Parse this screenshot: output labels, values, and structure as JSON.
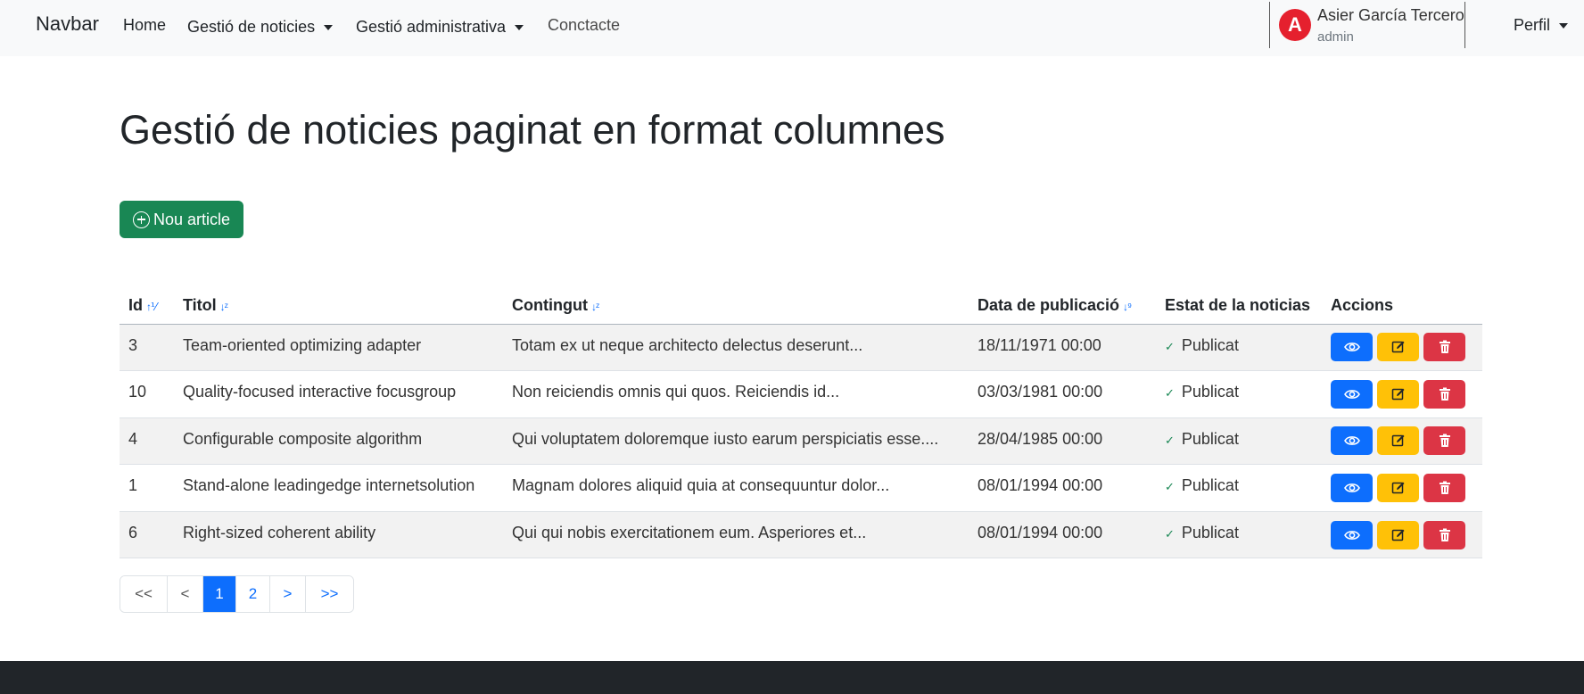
{
  "navbar": {
    "brand": "Navbar",
    "links": {
      "home": "Home",
      "gestio_noticies": "Gestió de noticies",
      "gestio_administrativa": "Gestió administrativa",
      "contacte": "Conctacte"
    },
    "user": {
      "avatar_letter": "A",
      "name": "Asier García Tercero",
      "role": "admin"
    },
    "perfil": "Perfil"
  },
  "page": {
    "title": "Gestió de noticies paginat en format columnes",
    "new_button": "Nou article"
  },
  "table": {
    "headers": {
      "id": "Id",
      "titol": "Titol",
      "contingut": "Contingut",
      "data": "Data de publicació",
      "estat": "Estat de la noticias",
      "accions": "Accions"
    },
    "rows": [
      {
        "id": "3",
        "titol": "Team-oriented optimizing adapter",
        "contingut": "Totam ex ut neque architecto delectus deserunt...",
        "data": "18/11/1971 00:00",
        "estat": "Publicat"
      },
      {
        "id": "10",
        "titol": "Quality-focused interactive focusgroup",
        "contingut": "Non reiciendis omnis qui quos. Reiciendis id...",
        "data": "03/03/1981 00:00",
        "estat": "Publicat"
      },
      {
        "id": "4",
        "titol": "Configurable composite algorithm",
        "contingut": "Qui voluptatem doloremque iusto earum perspiciatis esse....",
        "data": "28/04/1985 00:00",
        "estat": "Publicat"
      },
      {
        "id": "1",
        "titol": "Stand-alone leadingedge internetsolution",
        "contingut": "Magnam dolores aliquid quia at consequuntur dolor...",
        "data": "08/01/1994 00:00",
        "estat": "Publicat"
      },
      {
        "id": "6",
        "titol": "Right-sized coherent ability",
        "contingut": "Qui qui nobis exercitationem eum. Asperiores et...",
        "data": "08/01/1994 00:00",
        "estat": "Publicat"
      }
    ]
  },
  "pagination": {
    "first": "<<",
    "prev": "<",
    "pages": [
      "1",
      "2"
    ],
    "current": "1",
    "next": ">",
    "last": ">>"
  },
  "colors": {
    "primary": "#0d6efd",
    "success": "#198754",
    "warning": "#ffc107",
    "danger": "#dc3545",
    "footer": "#212529"
  },
  "icons": {
    "sort_numeric_up": "sort-numeric-up-icon",
    "sort_alpha_down": "sort-alpha-down-icon",
    "sort_numeric_down": "sort-numeric-down-icon",
    "status": "check-icon",
    "view": "eye-icon",
    "edit": "edit-icon",
    "delete": "trash-icon",
    "new": "plus-circle-icon"
  }
}
